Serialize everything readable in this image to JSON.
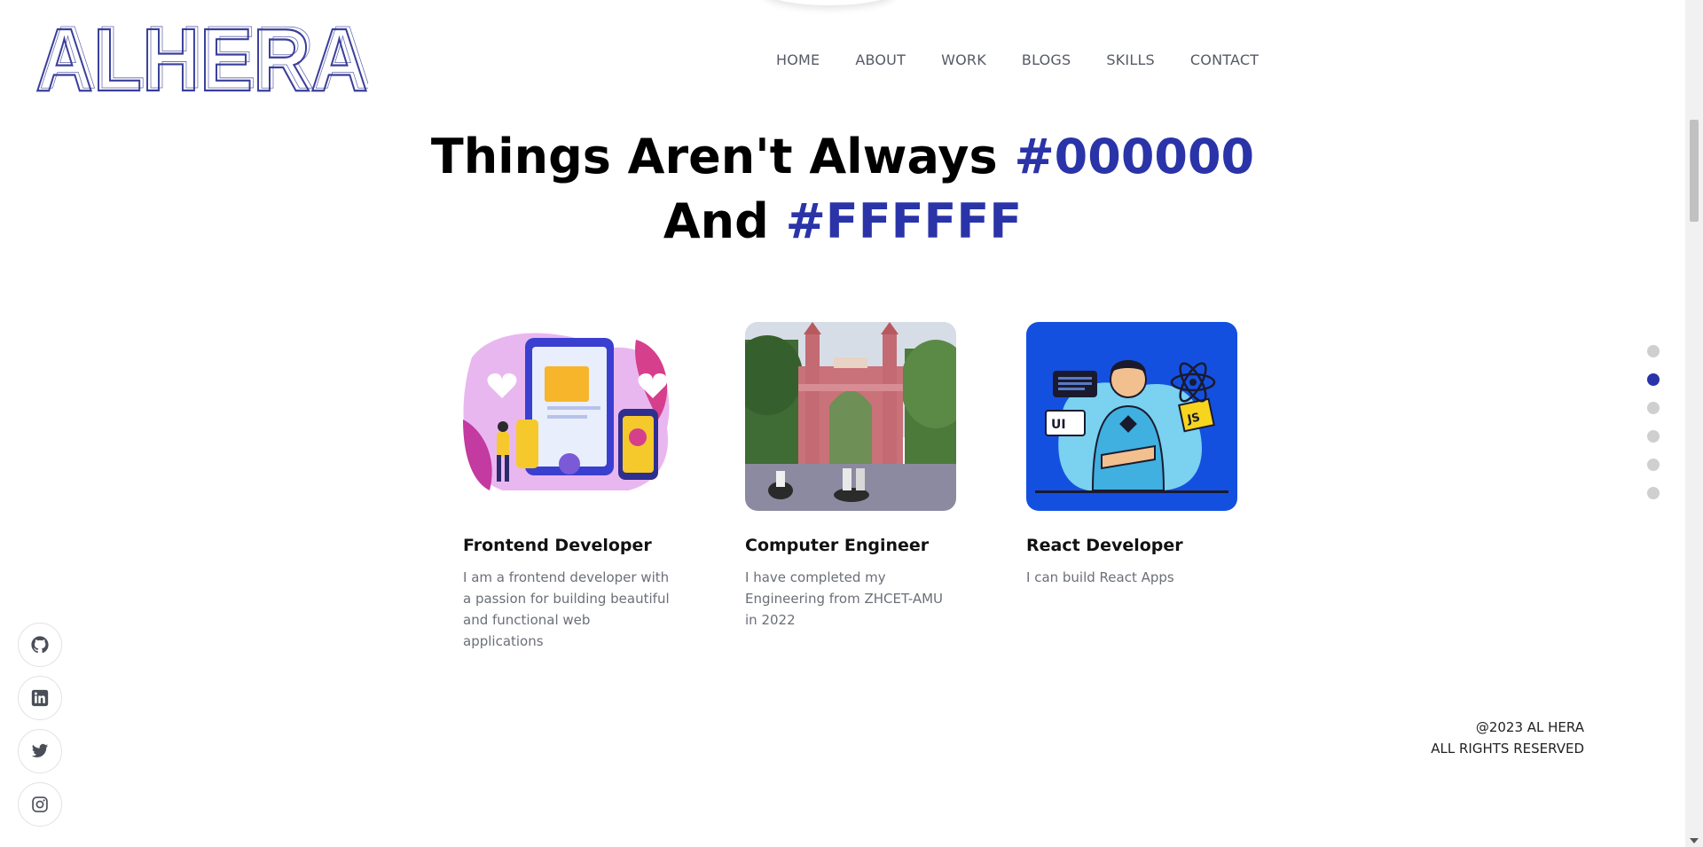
{
  "logo": {
    "text": "ALHERA"
  },
  "nav": {
    "items": [
      "HOME",
      "ABOUT",
      "WORK",
      "BLOGS",
      "SKILLS",
      "CONTACT"
    ]
  },
  "hero": {
    "line1_text": "Things Aren't Always ",
    "line1_accent": "#000000",
    "line2_text": "And ",
    "line2_accent": "#FFFFFF"
  },
  "cards": [
    {
      "title": "Frontend Developer",
      "desc": "I am a frontend developer with a passion for building beautiful and functional web applications"
    },
    {
      "title": "Computer Engineer",
      "desc": "I have completed my Engineering from ZHCET-AMU in 2022"
    },
    {
      "title": "React Developer",
      "desc": "I can build React Apps",
      "badges": [
        "UI",
        "JS"
      ]
    }
  ],
  "dots": {
    "count": 6,
    "active_index": 1
  },
  "social": [
    "github-icon",
    "linkedin-icon",
    "twitter-icon",
    "instagram-icon"
  ],
  "footer": {
    "line1": "@2023 AL HERA",
    "line2": "ALL RIGHTS RESERVED"
  },
  "colors": {
    "accent": "#2a34a8",
    "nav_text": "#555a65",
    "desc_text": "#6b6f78",
    "dot_inactive": "#cfcfcf"
  }
}
